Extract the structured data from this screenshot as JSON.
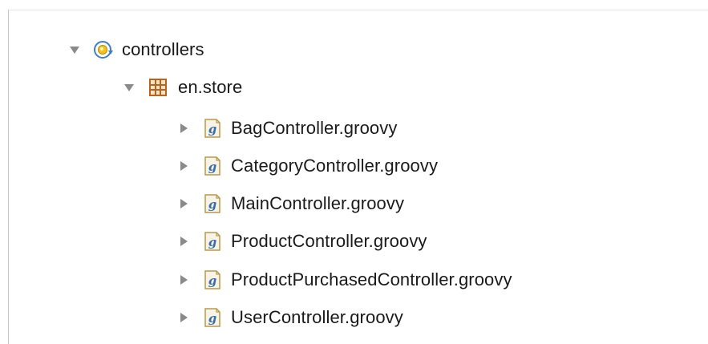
{
  "tree": {
    "root": {
      "label": "controllers",
      "expanded": true,
      "icon": "source-folder-icon"
    },
    "package": {
      "label": "en.store",
      "expanded": true,
      "icon": "package-icon"
    },
    "files": [
      {
        "label": "BagController.groovy",
        "icon": "groovy-file-icon",
        "expanded": false
      },
      {
        "label": "CategoryController.groovy",
        "icon": "groovy-file-icon",
        "expanded": false
      },
      {
        "label": "MainController.groovy",
        "icon": "groovy-file-icon",
        "expanded": false
      },
      {
        "label": "ProductController.groovy",
        "icon": "groovy-file-icon",
        "expanded": false
      },
      {
        "label": "ProductPurchasedController.groovy",
        "icon": "groovy-file-icon",
        "expanded": false
      },
      {
        "label": "UserController.groovy",
        "icon": "groovy-file-icon",
        "expanded": false
      }
    ]
  },
  "colors": {
    "twisty": "#8a8a8a",
    "package_grid": "#b5651d",
    "groovy_letter": "#3a6ea5",
    "source_folder_ring": "#3f7ec9",
    "source_folder_fill": "#f0c419"
  }
}
